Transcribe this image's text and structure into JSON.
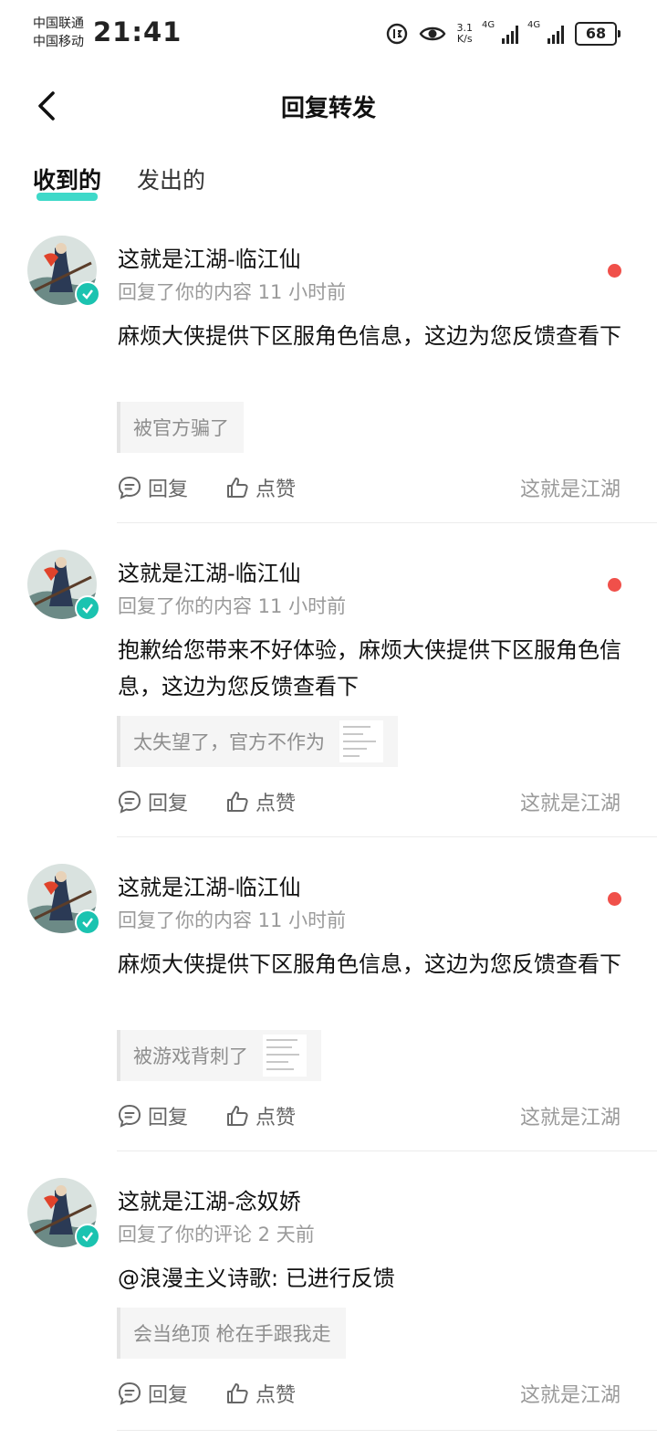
{
  "status_bar": {
    "carrier1": "中国联通",
    "carrier2": "中国移动",
    "time": "21:41",
    "speed_value": "3.1",
    "speed_unit": "K/s",
    "network1": "4G",
    "network2": "4G",
    "battery": "68"
  },
  "header": {
    "title": "回复转发"
  },
  "tabs": {
    "received": "收到的",
    "sent": "发出的"
  },
  "items": [
    {
      "name": "这就是江湖-临江仙",
      "meta": "回复了你的内容 11 小时前",
      "body": "麻烦大侠提供下区服角色信息，这边为您反馈查看下",
      "quote": "被官方骗了",
      "reply_label": "回复",
      "like_label": "点赞",
      "source": "这就是江湖"
    },
    {
      "name": "这就是江湖-临江仙",
      "meta": "回复了你的内容 11 小时前",
      "body": "抱歉给您带来不好体验，麻烦大侠提供下区服角色信息，这边为您反馈查看下",
      "quote": "太失望了，官方不作为",
      "reply_label": "回复",
      "like_label": "点赞",
      "source": "这就是江湖"
    },
    {
      "name": "这就是江湖-临江仙",
      "meta": "回复了你的内容 11 小时前",
      "body": "麻烦大侠提供下区服角色信息，这边为您反馈查看下",
      "quote": "被游戏背刺了",
      "reply_label": "回复",
      "like_label": "点赞",
      "source": "这就是江湖"
    },
    {
      "name": "这就是江湖-念奴娇",
      "meta": "回复了你的评论 2 天前",
      "body": "@浪漫主义诗歌: 已进行反馈",
      "quote": "会当绝顶 枪在手跟我走",
      "reply_label": "回复",
      "like_label": "点赞",
      "source": "这就是江湖"
    }
  ]
}
